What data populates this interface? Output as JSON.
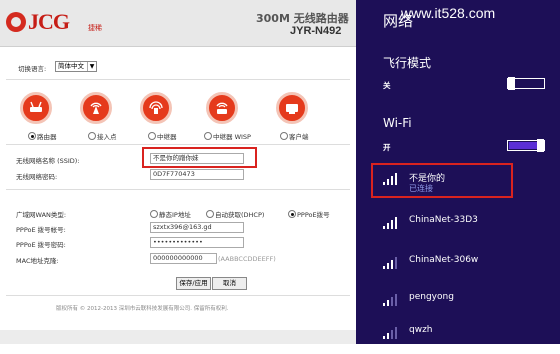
{
  "router": {
    "brand": "JCG",
    "brand_sub": "捷稀",
    "product_title": "300M 无线路由器",
    "product_model": "JYR-N492",
    "language_label": "切换语言:",
    "language_value": "简体中文",
    "modes": [
      {
        "label": "路由器",
        "selected": true,
        "icon": "router-icon"
      },
      {
        "label": "接入点",
        "selected": false,
        "icon": "access-point-icon"
      },
      {
        "label": "中继器",
        "selected": false,
        "icon": "repeater-icon"
      },
      {
        "label": "中继器 WISP",
        "selected": false,
        "icon": "wisp-icon"
      },
      {
        "label": "客户端",
        "selected": false,
        "icon": "client-icon"
      }
    ],
    "ssid_label": "无线网络名称 (SSID):",
    "ssid_value": "不是你的蹭你妹",
    "wifi_pwd_label": "无线网络密码:",
    "wifi_pwd_value": "0D7F770473",
    "wan_type_label": "广域网WAN类型:",
    "wan_types": [
      {
        "label": "静态IP地址",
        "selected": false
      },
      {
        "label": "自动获取(DHCP)",
        "selected": false
      },
      {
        "label": "PPPoE拨号",
        "selected": true
      }
    ],
    "pppoe_user_label": "PPPoE 拨号帐号:",
    "pppoe_user_value": "szxtx396@163.gd",
    "pppoe_pwd_label": "PPPoE 拨号密码:",
    "pppoe_pwd_value": "•••••••••••••",
    "mac_label": "MAC地址克隆:",
    "mac_value": "000000000000",
    "mac_hint": "(AABBCCDDEEFF)",
    "save_label": "保存/应用",
    "reset_label": "取消",
    "copyright": "版权所有 © 2012-2013 深圳市云联科技发展有限公司. 保留所有权利."
  },
  "flyout": {
    "title": "网络",
    "watermark": "www.it528.com",
    "airplane_label": "飞行模式",
    "airplane_state": "关",
    "airplane_on": false,
    "wifi_label": "Wi-Fi",
    "wifi_state": "开",
    "wifi_on": true,
    "networks": [
      {
        "name": "不是你的",
        "status": "已连接",
        "connected": true
      },
      {
        "name": "ChinaNet-33D3",
        "status": "",
        "connected": false
      },
      {
        "name": "ChinaNet-306w",
        "status": "",
        "connected": false
      },
      {
        "name": "pengyong",
        "status": "",
        "connected": false
      },
      {
        "name": "qwzh",
        "status": "",
        "connected": false
      }
    ]
  },
  "colors": {
    "flyout_bg": "#1d0f57",
    "toggle_on": "#5b2fd6",
    "highlight_red": "#d9231f",
    "brand_red": "#c61d16"
  }
}
